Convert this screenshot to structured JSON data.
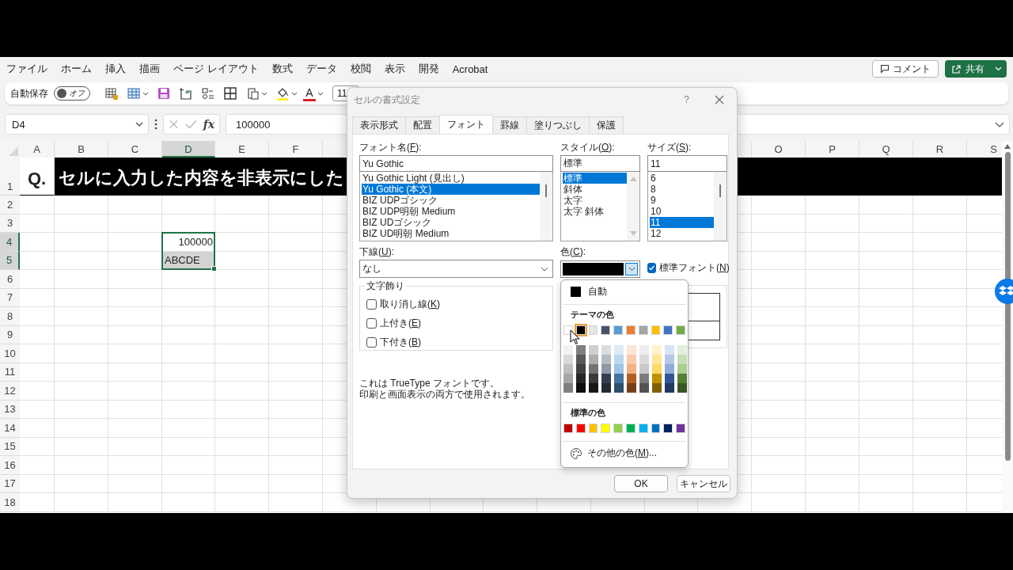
{
  "menu": [
    {
      "label": "ファイル"
    },
    {
      "label": "ホーム"
    },
    {
      "label": "挿入"
    },
    {
      "label": "描画"
    },
    {
      "label": "ページ レイアウト"
    },
    {
      "label": "数式"
    },
    {
      "label": "データ"
    },
    {
      "label": "校閲"
    },
    {
      "label": "表示"
    },
    {
      "label": "開発"
    },
    {
      "label": "Acrobat"
    }
  ],
  "header_buttons": {
    "comment": "コメント",
    "share": "共有"
  },
  "toolbar": {
    "autosave_label": "自動保存",
    "autosave": {
      "on": false,
      "label": "オフ"
    },
    "font_color_letter": "A",
    "font_size": "11"
  },
  "formula_bar": {
    "name_box": "D4",
    "function_label": "fx",
    "formula": "100000"
  },
  "sheet": {
    "columns": [
      {
        "label": "A",
        "selected": false
      },
      {
        "label": "B",
        "selected": false
      },
      {
        "label": "C",
        "selected": false
      },
      {
        "label": "D",
        "selected": true
      },
      {
        "label": "E",
        "selected": false
      },
      {
        "label": "F",
        "selected": false
      },
      {
        "label": "O",
        "selected": false
      },
      {
        "label": "P",
        "selected": false
      },
      {
        "label": "Q",
        "selected": false
      },
      {
        "label": "R",
        "selected": false
      },
      {
        "label": "S",
        "selected": false
      }
    ],
    "rows": [
      {
        "label": "1",
        "kind": "title",
        "selected": false,
        "cells": [
          {
            "text": "Q."
          },
          {
            "text": "セルに入力した内容を非表示にした"
          }
        ]
      },
      {
        "label": "2",
        "kind": "empty",
        "selected": false
      },
      {
        "label": "3",
        "kind": "empty",
        "selected": false
      },
      {
        "label": "4",
        "kind": "data",
        "selected": true,
        "cells": [
          {
            "text": "100000",
            "kind": "number",
            "selected": false
          }
        ]
      },
      {
        "label": "5",
        "kind": "data",
        "selected": true,
        "cells": [
          {
            "text": "ABCDE",
            "kind": "text",
            "selected": true
          }
        ]
      },
      {
        "label": "6",
        "kind": "empty",
        "selected": false
      },
      {
        "label": "7",
        "kind": "empty",
        "selected": false
      },
      {
        "label": "8",
        "kind": "empty",
        "selected": false
      },
      {
        "label": "9",
        "kind": "empty",
        "selected": false
      },
      {
        "label": "10",
        "kind": "empty",
        "selected": false
      },
      {
        "label": "11",
        "kind": "empty",
        "selected": false
      },
      {
        "label": "12",
        "kind": "empty",
        "selected": false
      },
      {
        "label": "13",
        "kind": "empty",
        "selected": false
      },
      {
        "label": "14",
        "kind": "empty",
        "selected": false
      },
      {
        "label": "15",
        "kind": "empty",
        "selected": false
      },
      {
        "label": "16",
        "kind": "empty",
        "selected": false
      },
      {
        "label": "17",
        "kind": "empty",
        "selected": false
      },
      {
        "label": "18",
        "kind": "empty",
        "selected": false
      }
    ]
  },
  "dialog": {
    "title": "セルの書式設定",
    "help": "?",
    "tabs": [
      {
        "label": "表示形式",
        "selected": false
      },
      {
        "label": "配置",
        "selected": false
      },
      {
        "label": "フォント",
        "selected": true
      },
      {
        "label": "罫線",
        "selected": false
      },
      {
        "label": "塗りつぶし",
        "selected": false
      },
      {
        "label": "保護",
        "selected": false
      }
    ],
    "font_name": {
      "label": [
        "フォント名(",
        "F",
        "):"
      ],
      "value": "Yu Gothic",
      "items": [
        {
          "label": "Yu Gothic Light (見出し)",
          "selected": false
        },
        {
          "label": "Yu Gothic (本文)",
          "selected": true
        },
        {
          "label": "BIZ UDPゴシック",
          "selected": false
        },
        {
          "label": "BIZ UDP明朝 Medium",
          "selected": false
        },
        {
          "label": "BIZ UDゴシック",
          "selected": false
        },
        {
          "label": "BIZ UD明朝 Medium",
          "selected": false
        }
      ]
    },
    "style": {
      "label": [
        "スタイル(",
        "O",
        "):"
      ],
      "value": "標準",
      "items": [
        {
          "label": "標準",
          "selected": true
        },
        {
          "label": "斜体",
          "selected": false
        },
        {
          "label": "太字",
          "selected": false
        },
        {
          "label": "太字 斜体",
          "selected": false
        }
      ]
    },
    "size": {
      "label": [
        "サイズ(",
        "S",
        "):"
      ],
      "value": "11",
      "items": [
        {
          "label": "6",
          "selected": false
        },
        {
          "label": "8",
          "selected": false
        },
        {
          "label": "9",
          "selected": false
        },
        {
          "label": "10",
          "selected": false
        },
        {
          "label": "11",
          "selected": true
        },
        {
          "label": "12",
          "selected": false
        }
      ]
    },
    "underline": {
      "label": [
        "下線(",
        "U",
        "):"
      ],
      "value": "なし"
    },
    "color": {
      "label": [
        "色(",
        "C",
        "):"
      ],
      "color": "#000000",
      "open": true
    },
    "normal_font": {
      "label": [
        "標準フォント(",
        "N",
        ")"
      ],
      "checked": true
    },
    "effects": {
      "title": "文字飾り",
      "items": [
        {
          "label": [
            "取り消し線(",
            "K",
            ")"
          ],
          "checked": false
        },
        {
          "label": [
            "上付き(",
            "E",
            ")"
          ],
          "checked": false
        },
        {
          "label": [
            "下付き(",
            "B",
            ")"
          ],
          "checked": false
        }
      ]
    },
    "info": [
      "これは TrueType フォントです。",
      "印刷と画面表示の両方で使用されます。"
    ],
    "buttons": [
      {
        "label": "OK",
        "kind": "default"
      },
      {
        "label": "キャンセル",
        "kind": "normal"
      }
    ],
    "color_menu": {
      "auto": {
        "label": "自動",
        "color": "#000000"
      },
      "theme_heading": "テーマの色",
      "theme_colors": [
        {
          "color": "#ffffff",
          "selected": false
        },
        {
          "color": "#000000",
          "selected": true
        },
        {
          "color": "#e7e6e6",
          "selected": false
        },
        {
          "color": "#44546a",
          "selected": false
        },
        {
          "color": "#5b9bd5",
          "selected": false
        },
        {
          "color": "#ed7d31",
          "selected": false
        },
        {
          "color": "#a5a5a5",
          "selected": false
        },
        {
          "color": "#ffc000",
          "selected": false
        },
        {
          "color": "#4472c4",
          "selected": false
        },
        {
          "color": "#70ad47",
          "selected": false
        }
      ],
      "standard_heading": "標準の色",
      "standard_colors": [
        {
          "color": "#c00000",
          "selected": false
        },
        {
          "color": "#ff0000",
          "selected": false
        },
        {
          "color": "#ffc000",
          "selected": false
        },
        {
          "color": "#ffff00",
          "selected": false
        },
        {
          "color": "#92d050",
          "selected": false
        },
        {
          "color": "#00b050",
          "selected": false
        },
        {
          "color": "#00b0f0",
          "selected": false
        },
        {
          "color": "#0070c0",
          "selected": false
        },
        {
          "color": "#002060",
          "selected": false
        },
        {
          "color": "#7030a0",
          "selected": false
        }
      ],
      "more": [
        "その他の色(",
        "M",
        ")..."
      ]
    }
  }
}
